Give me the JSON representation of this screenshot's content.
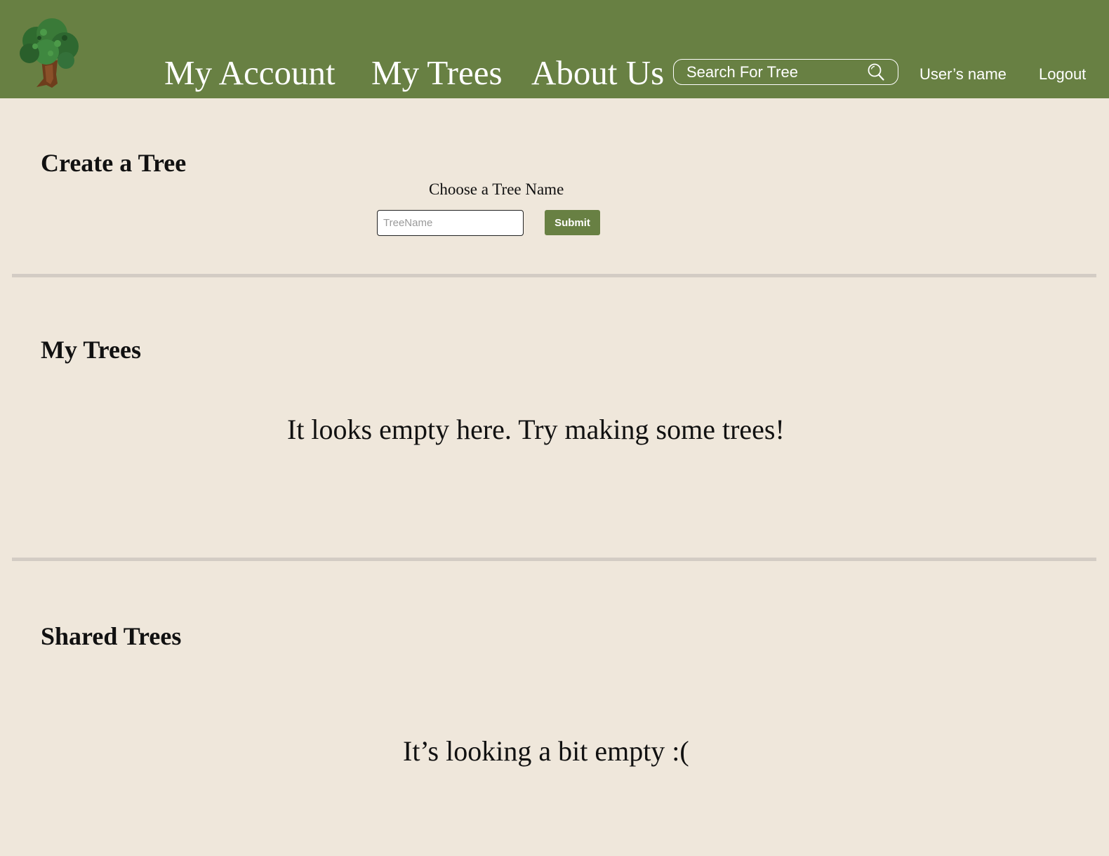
{
  "nav": {
    "links": [
      "My Account",
      "My Trees",
      "About Us"
    ],
    "search_placeholder": "Search For Tree",
    "user_name": "User’s name",
    "logout_label": "Logout"
  },
  "create": {
    "title": "Create a Tree",
    "label": "Choose a Tree Name",
    "input_placeholder": "TreeName",
    "submit_label": "Submit"
  },
  "my_trees": {
    "title": "My Trees",
    "empty_message": "It looks empty here. Try making some trees!"
  },
  "shared_trees": {
    "title": "Shared Trees",
    "empty_message": "It’s looking a bit empty :("
  },
  "colors": {
    "brand_green": "#688043",
    "page_background": "#efe7db",
    "divider": "#d3ccc4"
  },
  "icons": {
    "logo": "tree-logo-icon",
    "search": "search-icon"
  }
}
